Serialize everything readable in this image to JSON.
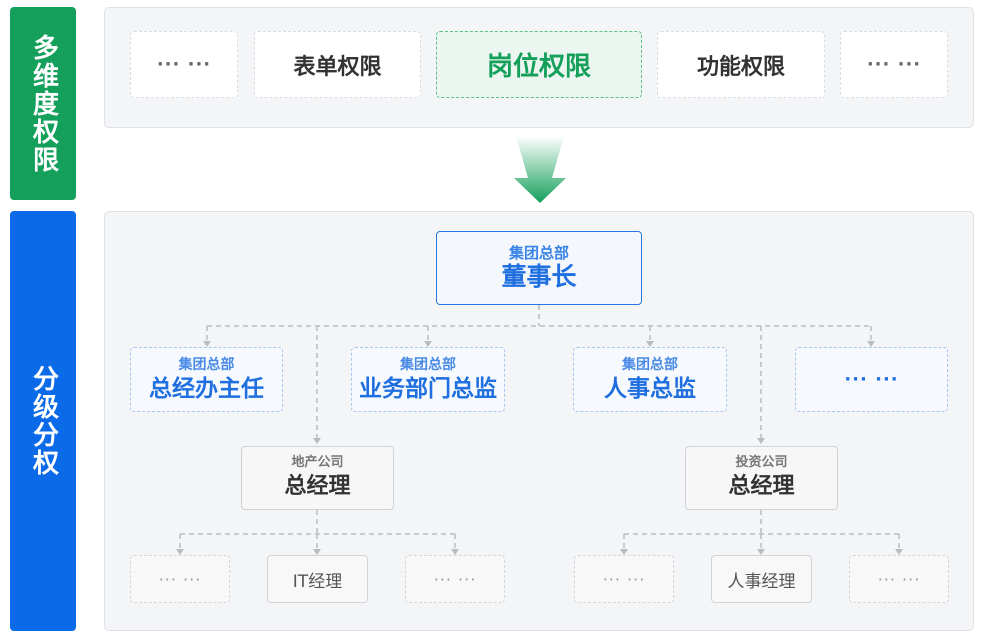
{
  "left_labels": {
    "top": "多维度权限",
    "bottom": "分级分权"
  },
  "tabs": [
    {
      "label": "··· ···",
      "state": "placeholder"
    },
    {
      "label": "表单权限",
      "state": "normal"
    },
    {
      "label": "岗位权限",
      "state": "active"
    },
    {
      "label": "功能权限",
      "state": "normal"
    },
    {
      "label": "··· ···",
      "state": "placeholder"
    }
  ],
  "org": {
    "root": {
      "unit": "集团总部",
      "role": "董事长"
    },
    "level2": [
      {
        "unit": "集团总部",
        "role": "总经办主任"
      },
      {
        "unit": "集团总部",
        "role": "业务部门总监"
      },
      {
        "unit": "集团总部",
        "role": "人事总监"
      },
      {
        "unit": "",
        "role": "··· ···"
      }
    ],
    "subsidiaries": [
      {
        "unit": "地产公司",
        "role": "总经理"
      },
      {
        "unit": "投资公司",
        "role": "总经理"
      }
    ],
    "leaves_left": [
      "··· ···",
      "IT经理",
      "··· ···"
    ],
    "leaves_right": [
      "··· ···",
      "人事经理",
      "··· ···"
    ]
  },
  "colors": {
    "green": "#14a05a",
    "blue": "#0a6ae8",
    "panel_bg": "#f4f5f7",
    "dashed_line": "#b8bcc2"
  }
}
